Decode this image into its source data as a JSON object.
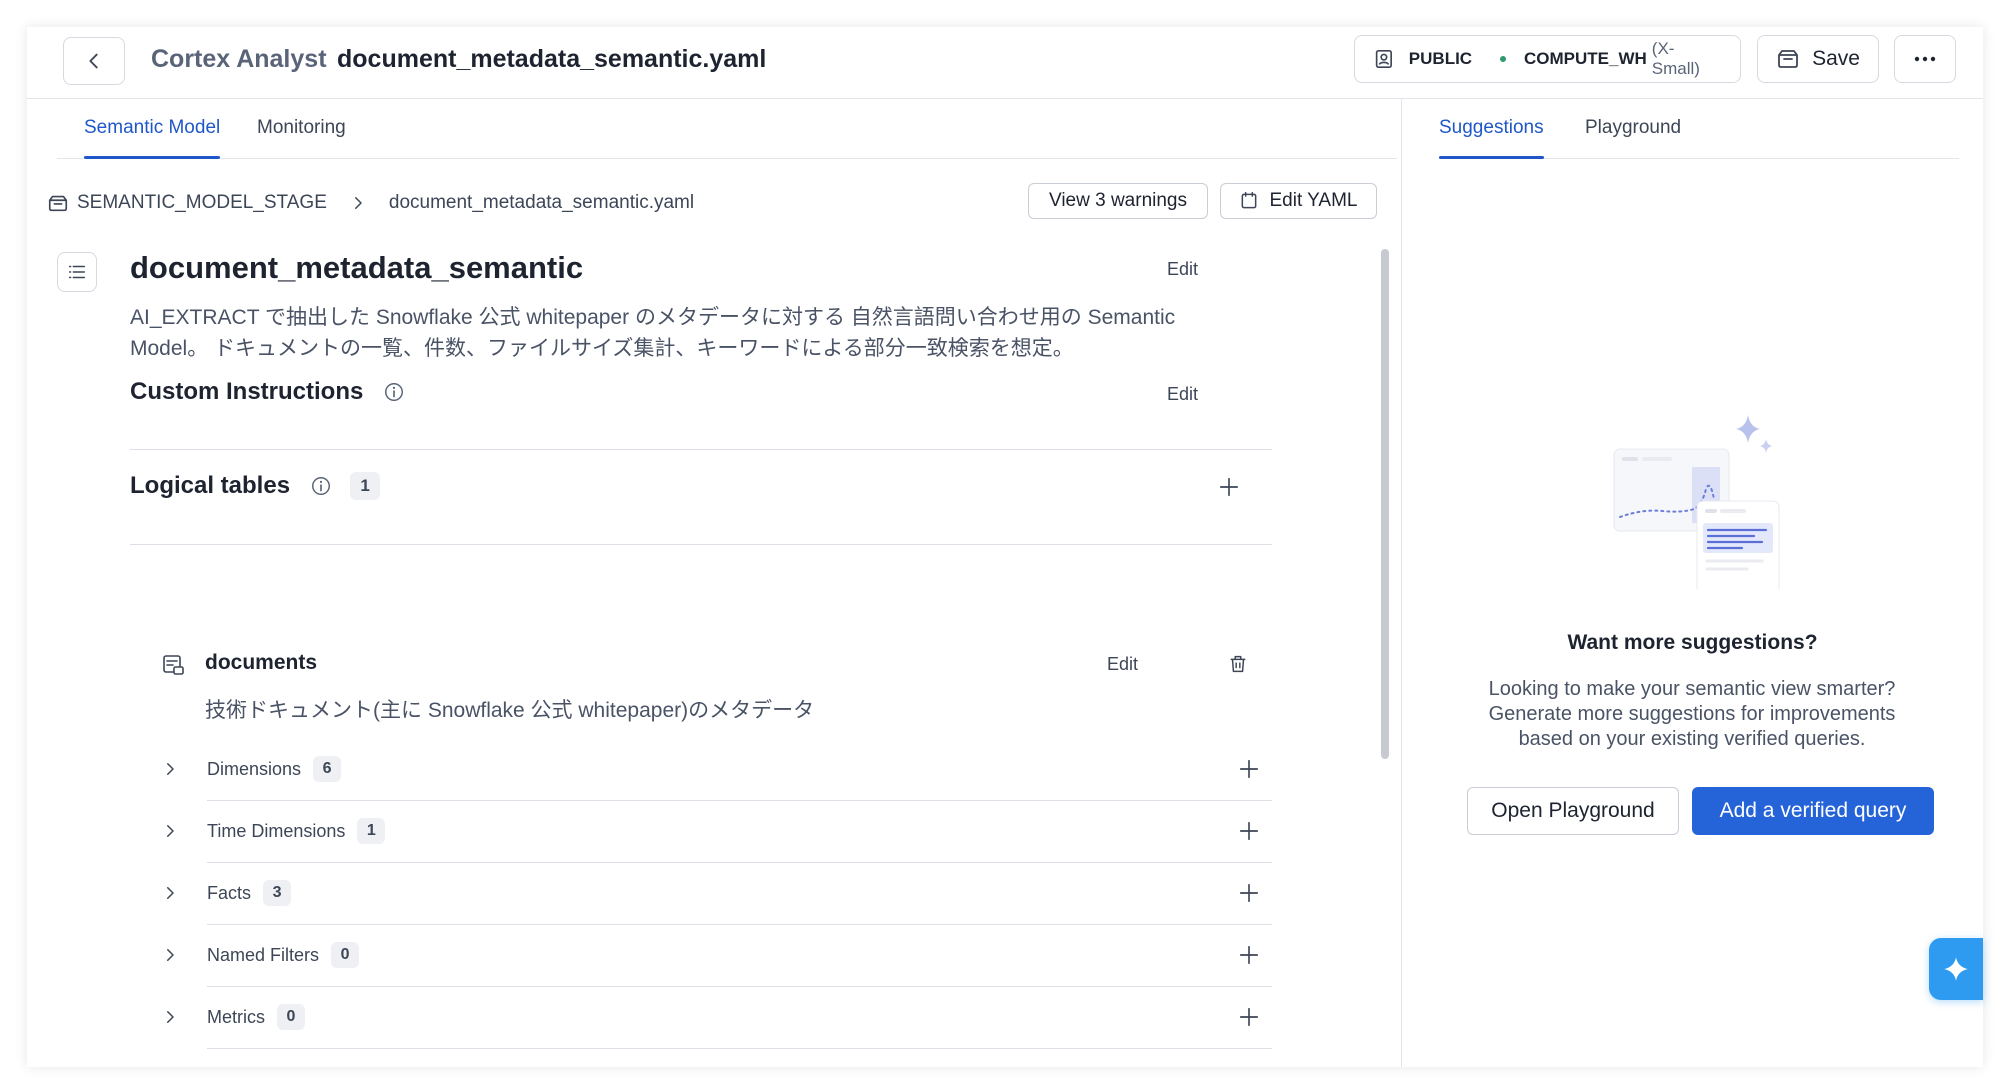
{
  "header": {
    "app_name": "Cortex Analyst",
    "file_title": "document_metadata_semantic.yaml",
    "role": "PUBLIC",
    "warehouse": "COMPUTE_WH",
    "warehouse_size": "(X-Small)",
    "save_label": "Save"
  },
  "left_tabs": [
    {
      "label": "Semantic Model",
      "active": true
    },
    {
      "label": "Monitoring",
      "active": false
    }
  ],
  "breadcrumb": {
    "stage": "SEMANTIC_MODEL_STAGE",
    "file": "document_metadata_semantic.yaml"
  },
  "toolbar": {
    "warnings_label": "View 3 warnings",
    "edit_yaml_label": "Edit YAML"
  },
  "model": {
    "name": "document_metadata_semantic",
    "edit_label": "Edit",
    "description_line1": "AI_EXTRACT で抽出した Snowflake 公式 whitepaper のメタデータに対する 自然言語問い合わせ用の Semantic",
    "description_line2": "Model。 ドキュメントの一覧、件数、ファイルサイズ集計、キーワードによる部分一致検索を想定。"
  },
  "custom_instructions": {
    "title": "Custom Instructions",
    "edit_label": "Edit"
  },
  "logical_tables": {
    "title": "Logical tables",
    "count": "1",
    "table": {
      "name": "documents",
      "edit_label": "Edit",
      "description": "技術ドキュメント(主に Snowflake 公式 whitepaper)のメタデータ",
      "groups": [
        {
          "label": "Dimensions",
          "count": "6"
        },
        {
          "label": "Time Dimensions",
          "count": "1"
        },
        {
          "label": "Facts",
          "count": "3"
        },
        {
          "label": "Named Filters",
          "count": "0"
        },
        {
          "label": "Metrics",
          "count": "0"
        }
      ]
    }
  },
  "right_tabs": [
    {
      "label": "Suggestions",
      "active": true
    },
    {
      "label": "Playground",
      "active": false
    }
  ],
  "suggestions": {
    "title": "Want more suggestions?",
    "line1": "Looking to make your semantic view smarter?",
    "line2": "Generate more suggestions for improvements",
    "line3": "based on your existing verified queries.",
    "open_playground_label": "Open Playground",
    "add_query_label": "Add a verified query"
  },
  "colors": {
    "accent": "#1f57c9",
    "primary_button": "#2563d8",
    "status_dot": "#2e9b6c",
    "ai_fab": "#2f9bf0"
  }
}
